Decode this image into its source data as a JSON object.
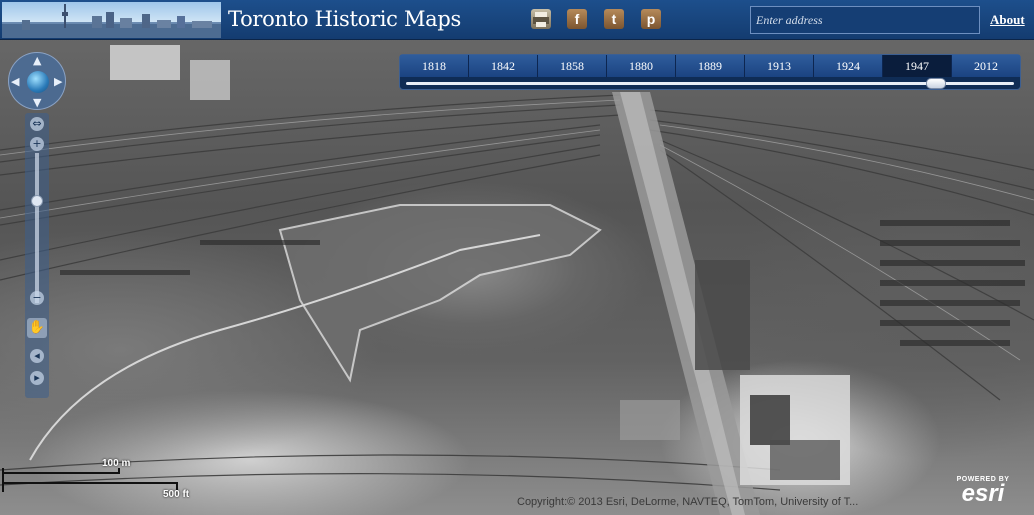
{
  "header": {
    "title": "Toronto Historic Maps",
    "search_placeholder": "Enter address",
    "about_label": "About",
    "icons": [
      "printer-icon",
      "facebook-icon",
      "twitter-icon",
      "pinterest-icon"
    ],
    "facebook_glyph": "f",
    "twitter_glyph": "t",
    "pinterest_glyph": "p"
  },
  "timeline": {
    "years": [
      "1818",
      "1842",
      "1858",
      "1880",
      "1889",
      "1913",
      "1924",
      "1947",
      "2012"
    ],
    "selected": "1947"
  },
  "scale": {
    "metric_label": "100 m",
    "imperial_label": "500 ft"
  },
  "copyright": "Copyright:© 2013 Esri, DeLorme, NAVTEQ, TomTom, University of T...",
  "esri": {
    "powered_by": "POWERED BY",
    "brand": "esri"
  },
  "colors": {
    "header_bg": "#1d4f8c",
    "year_active": "#0a1d3c",
    "year_default": "#2f5d9c"
  }
}
